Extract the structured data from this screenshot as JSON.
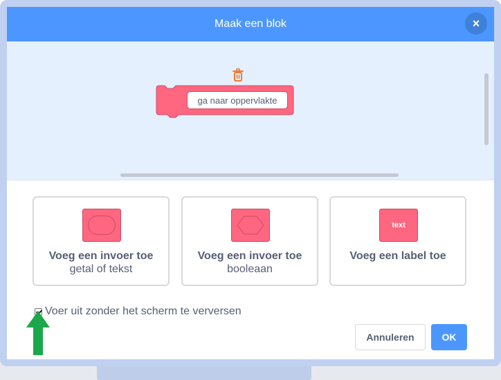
{
  "dialog": {
    "title": "Maak een blok",
    "close_glyph": "×"
  },
  "workspace": {
    "block_text": "ga naar oppervlakte",
    "trash_icon": "trash-icon"
  },
  "options": [
    {
      "title": "Voeg een invoer toe",
      "subtitle": "getal of tekst",
      "icon": "oval-input-icon"
    },
    {
      "title": "Voeg een invoer toe",
      "subtitle": "booleaan",
      "icon": "boolean-input-icon"
    },
    {
      "title": "Voeg een label toe",
      "subtitle": "",
      "icon": "label-icon",
      "icon_text": "text"
    }
  ],
  "checkbox": {
    "label": "Voer uit zonder het scherm te verversen",
    "checked": true
  },
  "buttons": {
    "cancel": "Annuleren",
    "ok": "OK"
  },
  "colors": {
    "header": "#4c97ff",
    "block": "#ff6680",
    "block_border": "#cc4c63",
    "workspace": "#e5f0ff",
    "arrow": "#1aa84b",
    "text": "#575e75"
  }
}
